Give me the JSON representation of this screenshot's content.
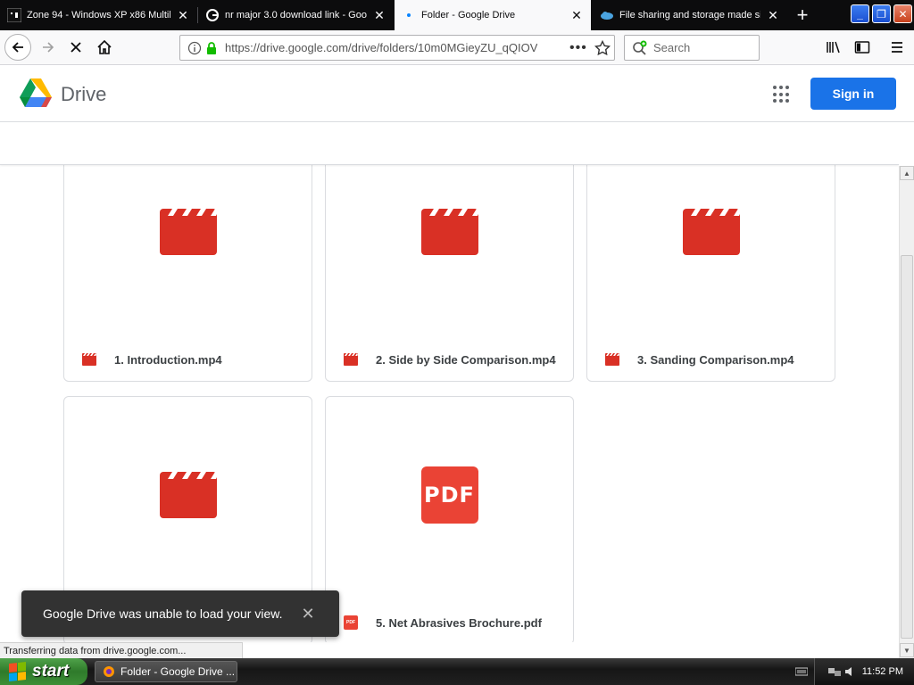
{
  "browser": {
    "tabs": [
      {
        "title": "Zone 94 - Windows XP x86 Multili",
        "favicon": "zone94-icon",
        "active": false
      },
      {
        "title": "nr major 3.0 download link - Goo",
        "favicon": "google-g-icon",
        "active": false
      },
      {
        "title": "Folder - Google Drive",
        "favicon": "loading-dot-icon",
        "active": true
      },
      {
        "title": "File sharing and storage made sir",
        "favicon": "cloud-icon",
        "active": false
      }
    ],
    "url": "https://drive.google.com/drive/folders/10m0MGieyZU_qQIOV",
    "url_domain": "drive.google.com",
    "search_placeholder": "Search"
  },
  "drive": {
    "app_name": "Drive",
    "signin_label": "Sign in",
    "files": [
      {
        "name": "1. Introduction.mp4",
        "type": "video"
      },
      {
        "name": "2. Side by Side Comparison.mp4",
        "type": "video"
      },
      {
        "name": "3. Sanding Comparison.mp4",
        "type": "video"
      },
      {
        "name": "",
        "type": "video"
      },
      {
        "name": "5. Net Abrasives Brochure.pdf",
        "type": "pdf"
      }
    ],
    "pdf_label": "PDF",
    "snackbar": "Google Drive was unable to load your view."
  },
  "status_text": "Transferring data from drive.google.com...",
  "taskbar": {
    "start_label": "start",
    "window_item": "Folder - Google Drive ...",
    "clock": "11:52 PM"
  },
  "colors": {
    "video_red": "#d93025",
    "pdf_red": "#ea4335",
    "signin_blue": "#1a73e8"
  }
}
